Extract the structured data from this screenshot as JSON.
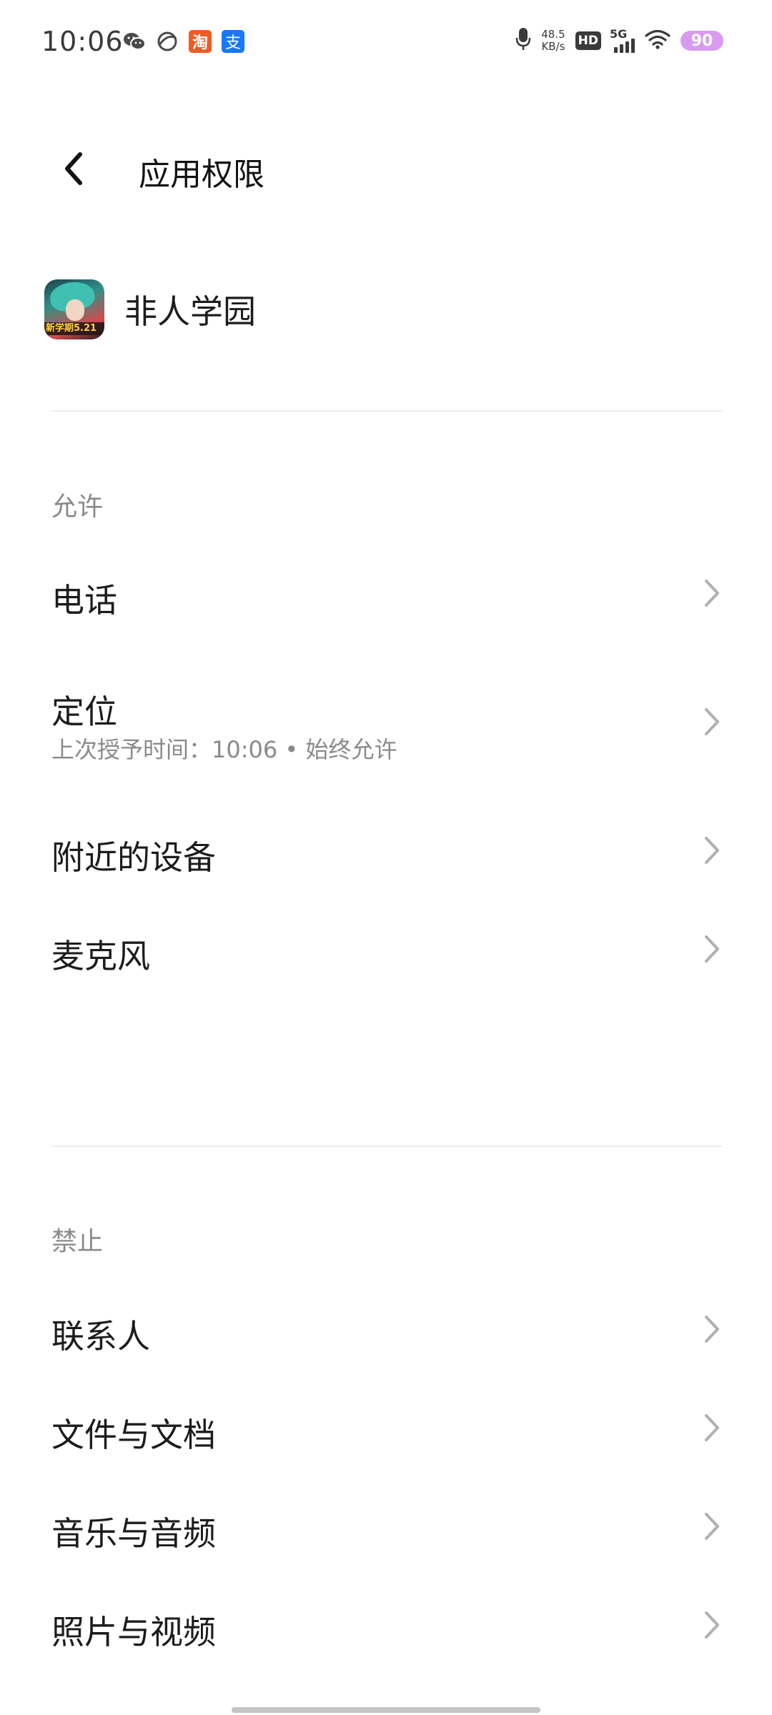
{
  "status_bar": {
    "time": "10:06",
    "notification_icons": [
      "wechat-icon",
      "moon-app-icon",
      "taobao-icon",
      "alipay-icon"
    ],
    "taobao_glyph": "淘",
    "alipay_glyph": "支",
    "net_speed_value": "48.5",
    "net_speed_unit": "KB/s",
    "hd_label": "HD",
    "network_label": "5G",
    "battery_level": "90",
    "battery_color": "#d79cf0"
  },
  "header": {
    "title": "应用权限"
  },
  "app": {
    "name": "非人学园",
    "icon_banner": "新学期5.21"
  },
  "allowed": {
    "label": "允许",
    "items": [
      {
        "label": "电话"
      },
      {
        "label": "定位",
        "subtitle": "上次授予时间：10:06 • 始终允许"
      },
      {
        "label": "附近的设备"
      },
      {
        "label": "麦克风"
      }
    ]
  },
  "denied": {
    "label": "禁止",
    "items": [
      {
        "label": "联系人"
      },
      {
        "label": "文件与文档"
      },
      {
        "label": "音乐与音频"
      },
      {
        "label": "照片与视频"
      }
    ]
  },
  "colors": {
    "text_primary": "#1c1c1c",
    "text_secondary": "#8a8a8a",
    "divider": "#ececec",
    "chevron": "#b0b0b0"
  }
}
